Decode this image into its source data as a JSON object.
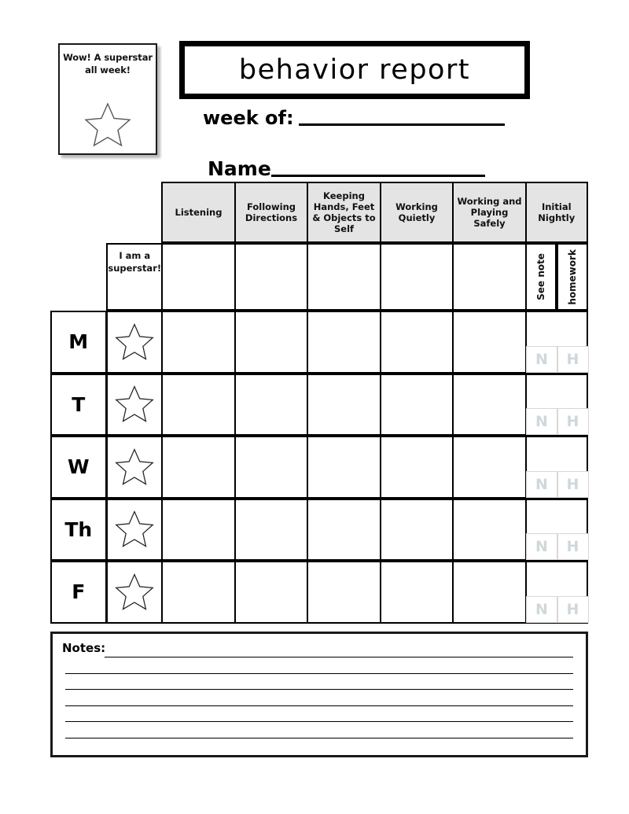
{
  "page": {
    "title": "behavior report"
  },
  "wow_badge": {
    "text": "Wow! A superstar all week!",
    "icon": "star-outline"
  },
  "fields": [
    {
      "label": "week of:",
      "value": "",
      "rule": true
    },
    {
      "label": "Name",
      "value": "",
      "rule": true
    }
  ],
  "table": {
    "column_headers": [
      "Listening",
      "Following Directions",
      "Keeping Hands, Feet & Objects to Self",
      "Working Quietly",
      "Working and Playing Safely",
      "Initial Nightly"
    ],
    "superstar_cell": "I am a superstar!",
    "initial_subheaders": [
      "See note",
      "homework"
    ],
    "initial_marks": [
      "N",
      "H"
    ],
    "day_rows": [
      {
        "label": "M",
        "icon": "star-outline",
        "marks": [
          "N",
          "H"
        ]
      },
      {
        "label": "T",
        "icon": "star-outline",
        "marks": [
          "N",
          "H"
        ]
      },
      {
        "label": "W",
        "icon": "star-outline",
        "marks": [
          "N",
          "H"
        ]
      },
      {
        "label": "Th",
        "icon": "star-outline",
        "marks": [
          "N",
          "H"
        ]
      },
      {
        "label": "F",
        "icon": "star-outline",
        "marks": [
          "N",
          "H"
        ]
      }
    ]
  },
  "notes": {
    "label": "Notes:",
    "line_count": 6,
    "value": ""
  },
  "colors": {
    "header_fill": "#e4e4e4",
    "border": "#000000",
    "mark_text": "#cfd8dc",
    "paper": "#ffffff"
  }
}
